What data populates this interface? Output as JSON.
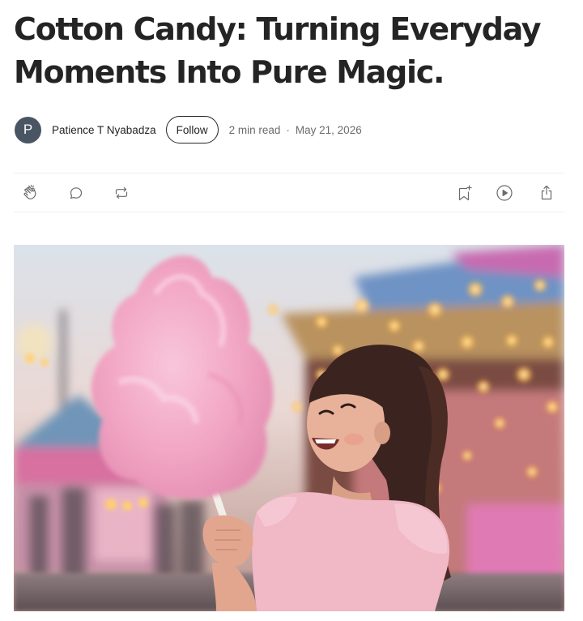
{
  "article": {
    "title": "Cotton Candy: Turning Everyday Moments Into Pure Magic.",
    "author": {
      "initial": "P",
      "name": "Patience T Nyabadza",
      "avatar_color": "#4a5563"
    },
    "follow_label": "Follow",
    "read_time": "2 min read",
    "separator": "·",
    "date": "May 21, 2026"
  },
  "action_bar": {
    "left": [
      {
        "icon": "clap-icon"
      },
      {
        "icon": "comment-icon"
      },
      {
        "icon": "repost-icon"
      }
    ],
    "right": [
      {
        "icon": "bookmark-add-icon"
      },
      {
        "icon": "play-icon"
      },
      {
        "icon": "share-icon"
      }
    ]
  },
  "hero_image": {
    "subject": "girl-with-pink-cotton-candy-at-carnival",
    "colors": {
      "sky": "#e6d6d2",
      "cotton_candy": "#f3a9c6",
      "dress": "#f1b8c6",
      "lights": "#ffd27a",
      "tent_roof": "#6b8fb8"
    }
  }
}
